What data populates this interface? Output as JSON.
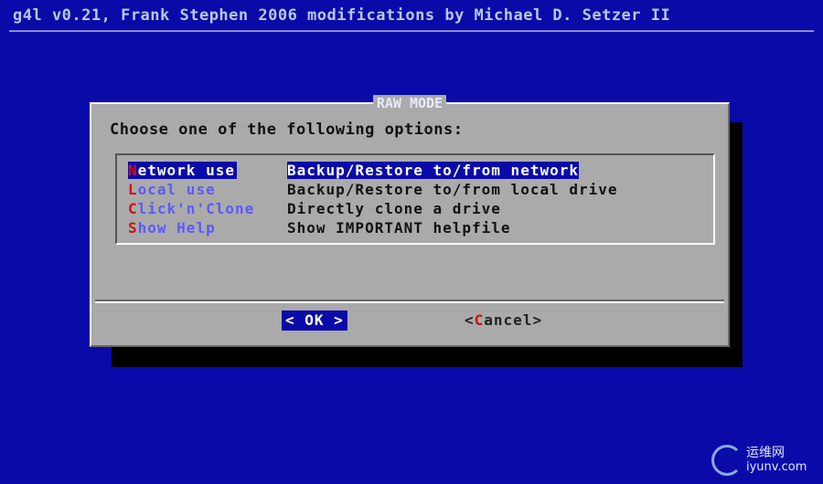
{
  "backtitle": "g4l v0.21, Frank Stephen 2006 modifications by Michael D. Setzer II",
  "dialog": {
    "title": "RAW MODE",
    "prompt": "Choose one of the following options:",
    "menu": [
      {
        "hotkey": "N",
        "rest": "etwork use",
        "description": "Backup/Restore to/from network",
        "selected": true
      },
      {
        "hotkey": "L",
        "rest": "ocal use",
        "description": "Backup/Restore to/from local drive",
        "selected": false
      },
      {
        "hotkey": "C",
        "rest": "lick'n'Clone",
        "description": "Directly clone a drive",
        "selected": false
      },
      {
        "hotkey": "S",
        "rest": "how Help",
        "description": "Show IMPORTANT helpfile",
        "selected": false
      }
    ],
    "ok_label": "< OK >",
    "cancel_prefix": "<",
    "cancel_hotkey": "C",
    "cancel_rest": "ancel>"
  },
  "watermark": {
    "cn": "运维网",
    "url": "iyunv.com"
  },
  "colors": {
    "screen_bg": "#0a0aa8",
    "dialog_bg": "#aaaaaa",
    "hotkey": "#cc1111",
    "tag": "#5a5aff",
    "selection": "#0a0aa8"
  }
}
